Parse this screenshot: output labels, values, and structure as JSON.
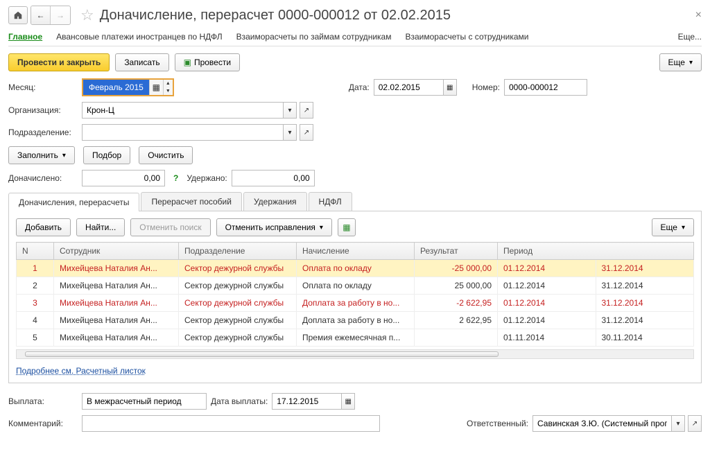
{
  "header": {
    "title": "Доначисление, перерасчет 0000-000012 от 02.02.2015"
  },
  "topTabs": {
    "main": "Главное",
    "advance": "Авансовые платежи иностранцев по НДФЛ",
    "loans": "Взаиморасчеты по займам сотрудникам",
    "employees": "Взаиморасчеты с сотрудниками",
    "more": "Еще..."
  },
  "toolbar": {
    "postClose": "Провести и закрыть",
    "save": "Записать",
    "post": "Провести",
    "more": "Еще"
  },
  "fields": {
    "monthLabel": "Месяц:",
    "monthValue": "Февраль 2015",
    "dateLabel": "Дата:",
    "dateValue": "02.02.2015",
    "numberLabel": "Номер:",
    "numberValue": "0000-000012",
    "orgLabel": "Организация:",
    "orgValue": "Крон-Ц",
    "depLabel": "Подразделение:",
    "depValue": "",
    "fill": "Заполнить",
    "pick": "Подбор",
    "clear": "Очистить",
    "accruedLabel": "Доначислено:",
    "accruedValue": "0,00",
    "withheldLabel": "Удержано:",
    "withheldValue": "0,00"
  },
  "sectionTabs": {
    "t1": "Доначисления, перерасчеты",
    "t2": "Перерасчет пособий",
    "t3": "Удержания",
    "t4": "НДФЛ"
  },
  "panelToolbar": {
    "add": "Добавить",
    "find": "Найти...",
    "cancelFind": "Отменить поиск",
    "cancelFix": "Отменить исправления",
    "more": "Еще"
  },
  "grid": {
    "headers": {
      "n": "N",
      "emp": "Сотрудник",
      "dep": "Подразделение",
      "nach": "Начисление",
      "res": "Результат",
      "per": "Период"
    },
    "rows": [
      {
        "n": "1",
        "emp": "Михейцева Наталия Ан...",
        "dep": "Сектор дежурной службы",
        "nach": "Оплата по окладу",
        "res": "-25 000,00",
        "p1": "01.12.2014",
        "p2": "31.12.2014",
        "red": true,
        "sel": true
      },
      {
        "n": "2",
        "emp": "Михейцева Наталия Ан...",
        "dep": "Сектор дежурной службы",
        "nach": "Оплата по окладу",
        "res": "25 000,00",
        "p1": "01.12.2014",
        "p2": "31.12.2014",
        "red": false,
        "sel": false
      },
      {
        "n": "3",
        "emp": "Михейцева Наталия Ан...",
        "dep": "Сектор дежурной службы",
        "nach": "Доплата за работу в но...",
        "res": "-2 622,95",
        "p1": "01.12.2014",
        "p2": "31.12.2014",
        "red": true,
        "sel": false
      },
      {
        "n": "4",
        "emp": "Михейцева Наталия Ан...",
        "dep": "Сектор дежурной службы",
        "nach": "Доплата за работу в но...",
        "res": "2 622,95",
        "p1": "01.12.2014",
        "p2": "31.12.2014",
        "red": false,
        "sel": false
      },
      {
        "n": "5",
        "emp": "Михейцева Наталия Ан...",
        "dep": "Сектор дежурной службы",
        "nach": "Премия ежемесячная п...",
        "res": "",
        "p1": "01.11.2014",
        "p2": "30.11.2014",
        "red": false,
        "sel": false
      }
    ]
  },
  "link": "Подробнее см. Расчетный листок",
  "footer": {
    "payoutLabel": "Выплата:",
    "payoutValue": "В межрасчетный период",
    "payoutDateLabel": "Дата выплаты:",
    "payoutDateValue": "17.12.2015",
    "commentLabel": "Комментарий:",
    "responsibleLabel": "Ответственный:",
    "responsibleValue": "Савинская З.Ю. (Системный прог"
  }
}
